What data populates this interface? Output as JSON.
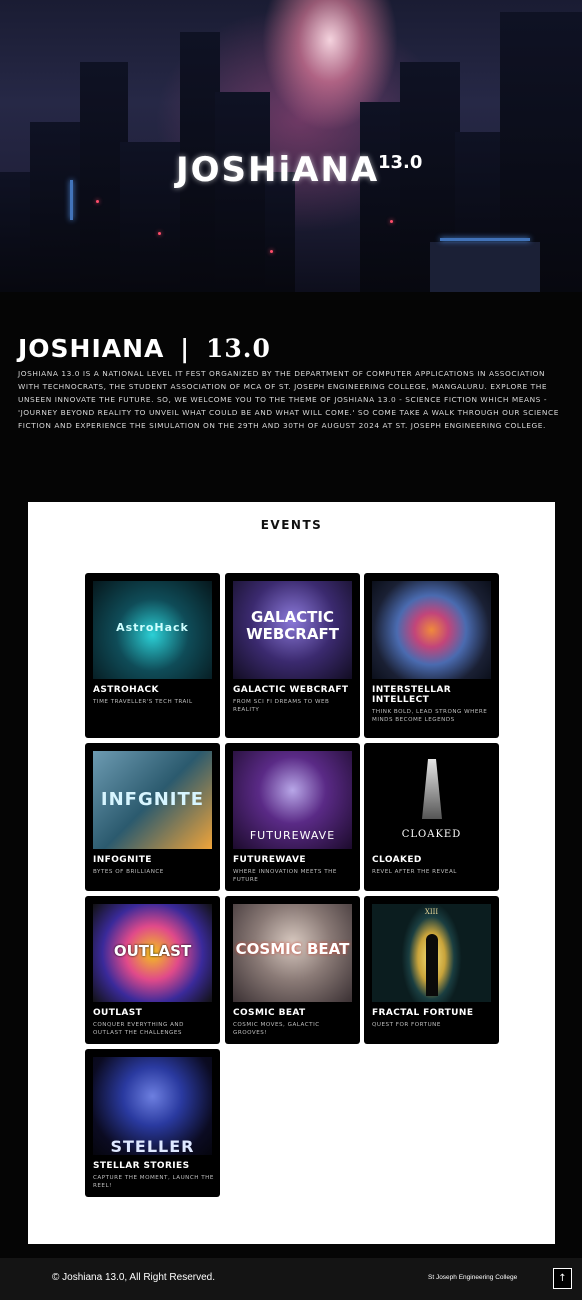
{
  "hero": {
    "title": "JOSHiANA",
    "version": "13.0"
  },
  "about": {
    "title": "JOSHIANA",
    "separator": "|",
    "version": "13.0",
    "text": "Joshiana 13.0 is a national level IT fest organized by the department of computer applications in association with TechnoCrats, the student association of MCA of St. Joseph Engineering College, Mangaluru. Explore the unseen innovate the future. So, we welcome you to the theme of Joshiana 13.0 - Science Fiction which means - 'Journey Beyond Reality to Unveil What Could Be and What Will Come.' So come take a walk through our science fiction and experience the simulation on the 29th and 30th of August 2024 at St. Joseph Engineering College."
  },
  "events": {
    "title": "EVENTS",
    "items": [
      {
        "name": "Astrohack",
        "tagline": "Time traveller's tech trail",
        "thumb_text": "AstroHack",
        "thumb_color": "#0e3b44"
      },
      {
        "name": "Galactic Webcraft",
        "tagline": "From sci fi dreams to web reality",
        "thumb_text": "GALACTIC WEBCRAFT",
        "thumb_color": "#2a1f4a"
      },
      {
        "name": "Interstellar Intellect",
        "tagline": "Think bold, lead strong where minds become legends",
        "thumb_text": "",
        "thumb_color": "#1e2436"
      },
      {
        "name": "Infognite",
        "tagline": "Bytes of brilliance",
        "thumb_text": "INFGNITE",
        "thumb_color": "#26475a"
      },
      {
        "name": "Futurewave",
        "tagline": "Where innovation meets the future",
        "thumb_text": "FUTUREWAVE",
        "thumb_color": "#2b1238"
      },
      {
        "name": "Cloaked",
        "tagline": "Revel after the reveal",
        "thumb_text": "CLOAKED",
        "thumb_color": "#000000"
      },
      {
        "name": "Outlast",
        "tagline": "Conquer everything and outlast the challenges",
        "thumb_text": "OUTLAST",
        "thumb_color": "#1a1a1a"
      },
      {
        "name": "Cosmic Beat",
        "tagline": "Cosmic moves, galactic grooves!",
        "thumb_text": "COSMIC BEAT",
        "thumb_color": "#6a5a5a"
      },
      {
        "name": "Fractal Fortune",
        "tagline": "Quest for fortune",
        "thumb_text": "XIII",
        "thumb_color": "#0d2a2c"
      },
      {
        "name": "Stellar Stories",
        "tagline": "Capture the moment, launch the reel!",
        "thumb_text": "STELLER",
        "thumb_color": "#0a0a16"
      }
    ]
  },
  "footer": {
    "copyright": "© Joshiana 13.0, All Right Reserved.",
    "college": "St Joseph Engineering College",
    "back_to_top_icon": "↑"
  },
  "colors": {
    "background": "#050505",
    "panel": "#ffffff",
    "card": "#000000",
    "footer": "#141414"
  }
}
